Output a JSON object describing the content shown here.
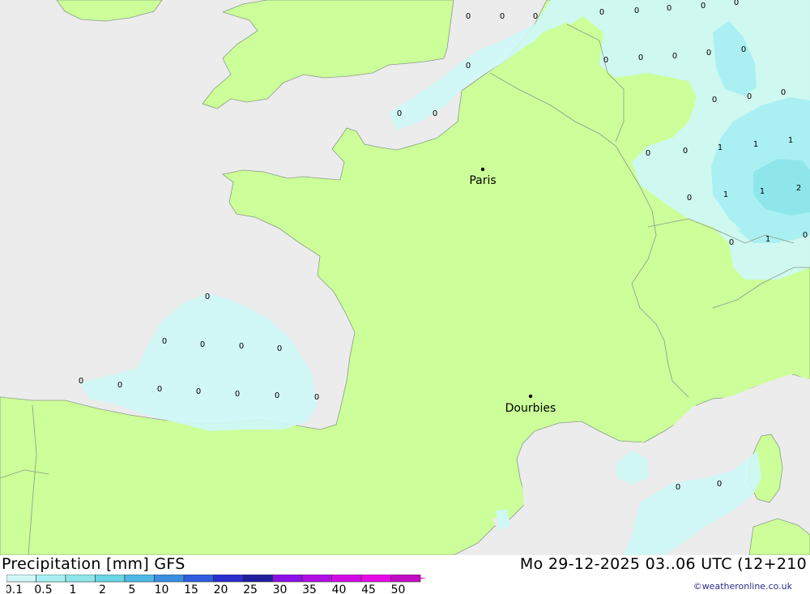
{
  "map": {
    "colors": {
      "sea": "#ececec",
      "land": "#ccff99",
      "border": "#8a9a8a",
      "precip_light": "#cff7f7",
      "precip_mid": "#aaf0f2",
      "precip_heavy": "#8ee6ea"
    },
    "cities": [
      {
        "name": "Paris"
      },
      {
        "name": "Dourbies"
      }
    ],
    "values": [
      "0",
      "0",
      "0",
      "0",
      "0",
      "0",
      "0",
      "0",
      "0",
      "0",
      "0",
      "0",
      "0",
      "0",
      "0",
      "0",
      "0",
      "0",
      "0",
      "0",
      "0",
      "1",
      "1",
      "1",
      "0",
      "1",
      "1",
      "2",
      "0",
      "1",
      "0",
      "0",
      "0",
      "0",
      "0",
      "0",
      "0",
      "0",
      "0",
      "0",
      "0",
      "0",
      "0",
      "0",
      "0",
      "0",
      "0"
    ]
  },
  "footer": {
    "title": "Precipitation [mm] GFS",
    "date": "Mo 29-12-2025 03..06 UTC (12+210",
    "credit": "©weatheronline.co.uk"
  },
  "legend": {
    "labels": [
      "0.1",
      "0.5",
      "1",
      "2",
      "5",
      "10",
      "15",
      "20",
      "25",
      "30",
      "35",
      "40",
      "45",
      "50"
    ],
    "colors": [
      "#cff7f7",
      "#aaf0f2",
      "#8ee6ea",
      "#6ad6e6",
      "#4fb8e6",
      "#3a8ee0",
      "#2e5ee0",
      "#2b2fcf",
      "#1f1f9e",
      "#8a10e6",
      "#b10ee6",
      "#d40ae6",
      "#e60ae6",
      "#c20ac2"
    ]
  }
}
